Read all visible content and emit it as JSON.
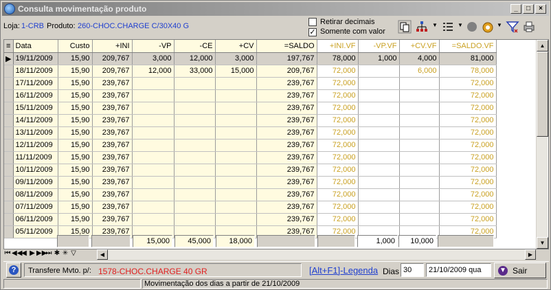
{
  "window": {
    "title": "Consulta movimentação produto"
  },
  "info": {
    "loja_label": "Loja:",
    "loja_value": "1-CRB",
    "produto_label": "Produto:",
    "produto_value": "260-CHOC.CHARGE C/30X40 G",
    "retirar_label": "Retirar decimais",
    "retirar_checked": false,
    "somente_label": "Somente com valor",
    "somente_checked": true
  },
  "grid": {
    "columns": [
      "Data",
      "Custo",
      "+INI",
      "-VP",
      "-CE",
      "+CV",
      "=SALDO",
      "+INI.VF",
      "-VP.VF",
      "+CV.VF",
      "=SALDO.VF"
    ],
    "rows": [
      [
        "19/11/2009",
        "15,90",
        "209,767",
        "3,000",
        "12,000",
        "3,000",
        "197,767",
        "78,000",
        "1,000",
        "4,000",
        "81,000"
      ],
      [
        "18/11/2009",
        "15,90",
        "209,767",
        "12,000",
        "33,000",
        "15,000",
        "209,767",
        "72,000",
        "",
        "6,000",
        "78,000"
      ],
      [
        "17/11/2009",
        "15,90",
        "239,767",
        "",
        "",
        "",
        "239,767",
        "72,000",
        "",
        "",
        "72,000"
      ],
      [
        "16/11/2009",
        "15,90",
        "239,767",
        "",
        "",
        "",
        "239,767",
        "72,000",
        "",
        "",
        "72,000"
      ],
      [
        "15/11/2009",
        "15,90",
        "239,767",
        "",
        "",
        "",
        "239,767",
        "72,000",
        "",
        "",
        "72,000"
      ],
      [
        "14/11/2009",
        "15,90",
        "239,767",
        "",
        "",
        "",
        "239,767",
        "72,000",
        "",
        "",
        "72,000"
      ],
      [
        "13/11/2009",
        "15,90",
        "239,767",
        "",
        "",
        "",
        "239,767",
        "72,000",
        "",
        "",
        "72,000"
      ],
      [
        "12/11/2009",
        "15,90",
        "239,767",
        "",
        "",
        "",
        "239,767",
        "72,000",
        "",
        "",
        "72,000"
      ],
      [
        "11/11/2009",
        "15,90",
        "239,767",
        "",
        "",
        "",
        "239,767",
        "72,000",
        "",
        "",
        "72,000"
      ],
      [
        "10/11/2009",
        "15,90",
        "239,767",
        "",
        "",
        "",
        "239,767",
        "72,000",
        "",
        "",
        "72,000"
      ],
      [
        "09/11/2009",
        "15,90",
        "239,767",
        "",
        "",
        "",
        "239,767",
        "72,000",
        "",
        "",
        "72,000"
      ],
      [
        "08/11/2009",
        "15,90",
        "239,767",
        "",
        "",
        "",
        "239,767",
        "72,000",
        "",
        "",
        "72,000"
      ],
      [
        "07/11/2009",
        "15,90",
        "239,767",
        "",
        "",
        "",
        "239,767",
        "72,000",
        "",
        "",
        "72,000"
      ],
      [
        "06/11/2009",
        "15,90",
        "239,767",
        "",
        "",
        "",
        "239,767",
        "72,000",
        "",
        "",
        "72,000"
      ],
      [
        "05/11/2009",
        "15,90",
        "239,767",
        "",
        "",
        "",
        "239,767",
        "72,000",
        "",
        "",
        "72,000"
      ]
    ],
    "totals": {
      "vp": "15,000",
      "ce": "45,000",
      "cv": "18,000",
      "vp_vf": "1,000",
      "cv_vf": "10,000"
    }
  },
  "bottom": {
    "transfere_label": "Transfere Mvto. p/:",
    "transfere_value": "1578-CHOC.CHARGE 40 GR",
    "legenda_link": "[Alt+F1]-Legenda",
    "dias_label": "Dias",
    "dias_value": "30",
    "date_value": "21/10/2009 qua",
    "sair_label": "Sair",
    "status_text": "Movimentação dos dias a partir de 21/10/2009"
  },
  "colors": {
    "vf_text": "#c9a020",
    "grid_bg": "#fffbe0",
    "link_blue": "#1f3fcf",
    "transfer_red": "#e02020"
  }
}
